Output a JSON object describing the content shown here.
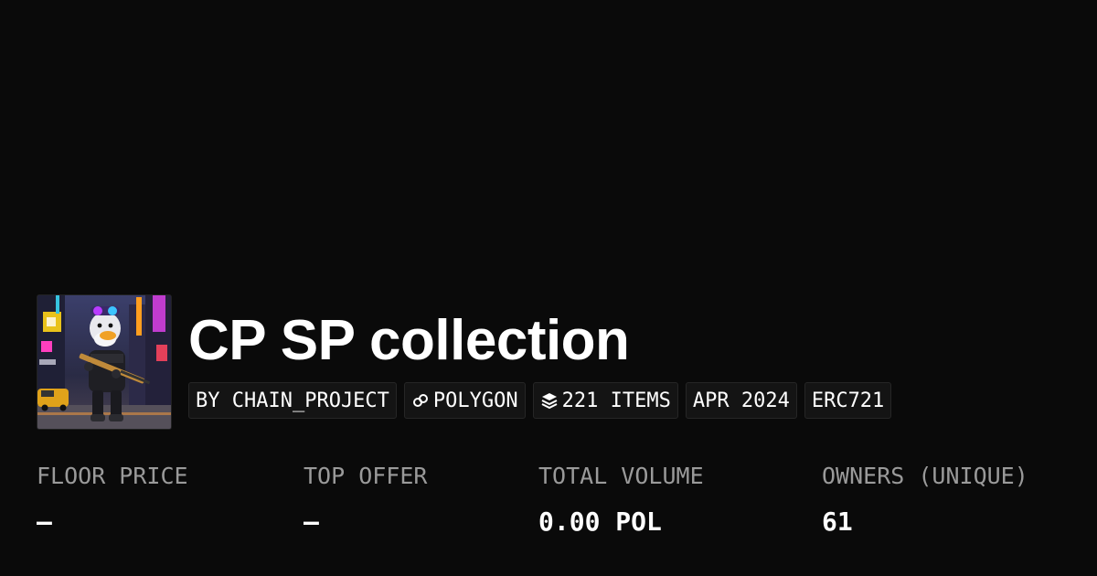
{
  "collection": {
    "title": "CP SP collection",
    "avatar_alt": "duck soldier artwork"
  },
  "badges": [
    {
      "label": "BY CHAIN_PROJECT",
      "icon": ""
    },
    {
      "label": "POLYGON",
      "icon": "polygon-chain-icon"
    },
    {
      "label": "221 ITEMS",
      "icon": "layers-icon"
    },
    {
      "label": "APR 2024",
      "icon": ""
    },
    {
      "label": "ERC721",
      "icon": ""
    }
  ],
  "stats": [
    {
      "label": "FLOOR PRICE",
      "value": "–"
    },
    {
      "label": "TOP OFFER",
      "value": "–"
    },
    {
      "label": "TOTAL VOLUME",
      "value": "0.00 POL"
    },
    {
      "label": "OWNERS (UNIQUE)",
      "value": "61"
    }
  ],
  "colors": {
    "background": "#0a0a0a",
    "badge_background": "#141414",
    "badge_border": "#262626",
    "label_gray": "#9a9a9a",
    "text": "#ffffff"
  }
}
